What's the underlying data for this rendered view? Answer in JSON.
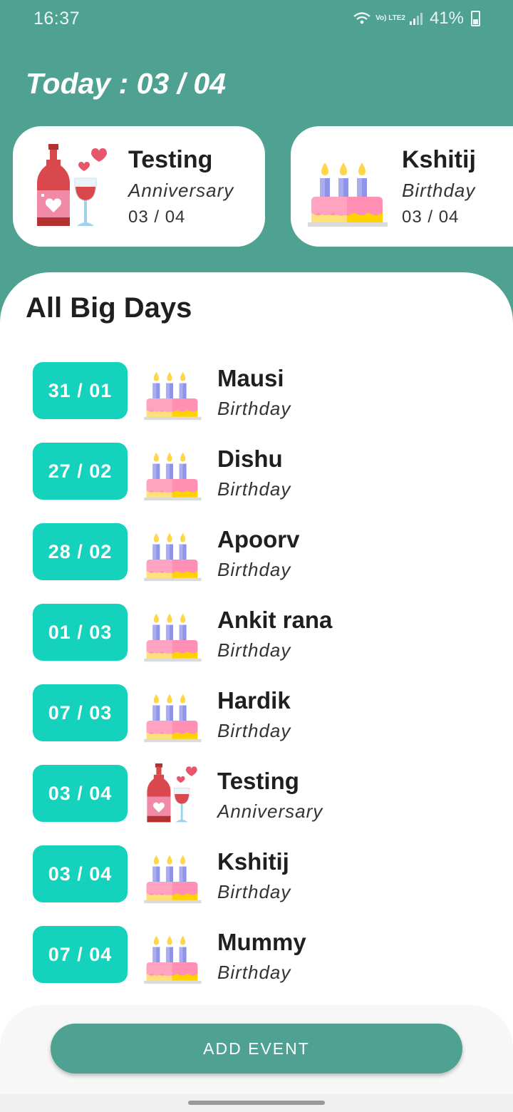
{
  "status_bar": {
    "time": "16:37",
    "network": "Vo) LTE2",
    "battery": "41%"
  },
  "header": {
    "today_label": "Today : 03 / 04"
  },
  "today_cards": [
    {
      "name": "Testing",
      "type": "Anniversary",
      "date": "03 / 04",
      "icon": "anniversary-wine-icon"
    },
    {
      "name": "Kshitij",
      "type": "Birthday",
      "date": "03 / 04",
      "icon": "birthday-cake-icon"
    }
  ],
  "list": {
    "title": "All Big Days",
    "events": [
      {
        "date": "31 / 01",
        "name": "Mausi",
        "type": "Birthday",
        "icon": "birthday-cake-icon"
      },
      {
        "date": "27 / 02",
        "name": "Dishu",
        "type": "Birthday",
        "icon": "birthday-cake-icon"
      },
      {
        "date": "28 / 02",
        "name": "Apoorv",
        "type": "Birthday",
        "icon": "birthday-cake-icon"
      },
      {
        "date": "01 / 03",
        "name": "Ankit rana",
        "type": "Birthday",
        "icon": "birthday-cake-icon"
      },
      {
        "date": "07 / 03",
        "name": "Hardik",
        "type": "Birthday",
        "icon": "birthday-cake-icon"
      },
      {
        "date": "03 / 04",
        "name": "Testing",
        "type": "Anniversary",
        "icon": "anniversary-wine-icon"
      },
      {
        "date": "03 / 04",
        "name": "Kshitij",
        "type": "Birthday",
        "icon": "birthday-cake-icon"
      },
      {
        "date": "07 / 04",
        "name": "Mummy",
        "type": "Birthday",
        "icon": "birthday-cake-icon"
      }
    ]
  },
  "actions": {
    "add_event_label": "ADD EVENT"
  },
  "colors": {
    "primary": "#4fa191",
    "accent": "#14d2bb",
    "card": "#ffffff"
  }
}
